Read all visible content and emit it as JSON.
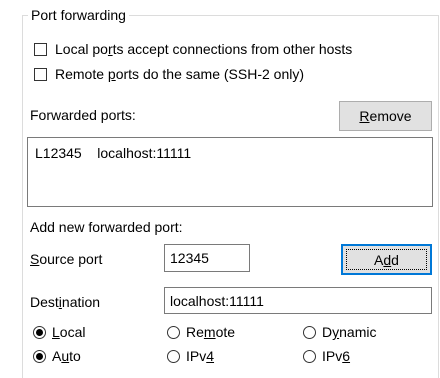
{
  "group": {
    "title": "Port forwarding"
  },
  "checkboxes": {
    "local": {
      "pre": "Local po",
      "key": "r",
      "post": "ts accept connections from other hosts",
      "checked": false
    },
    "remote": {
      "pre": "Remote ",
      "key": "p",
      "post": "orts do the same (SSH-2 only)",
      "checked": false
    }
  },
  "forwarded": {
    "label": "Forwarded ports:",
    "remove_button": {
      "pre": "",
      "key": "R",
      "post": "emove"
    },
    "items": [
      {
        "source": "L12345",
        "dest": "localhost:11111"
      }
    ]
  },
  "add_new": {
    "label": "Add new forwarded port:",
    "source_label": {
      "pre": "",
      "key": "S",
      "post": "ource port"
    },
    "source_value": "12345",
    "add_button": {
      "pre": "A",
      "key": "d",
      "post": "d"
    },
    "destination_label": {
      "pre": "Dest",
      "key": "i",
      "post": "nation"
    },
    "destination_value": "localhost:11111"
  },
  "direction": {
    "local": {
      "pre": "",
      "key": "L",
      "post": "ocal",
      "checked": true
    },
    "remote": {
      "pre": "Re",
      "key": "m",
      "post": "ote",
      "checked": false
    },
    "dynamic": {
      "pre": "D",
      "key": "y",
      "post": "namic",
      "checked": false
    }
  },
  "protocol": {
    "auto": {
      "pre": "A",
      "key": "u",
      "post": "to",
      "checked": true
    },
    "ipv4": {
      "pre": "IPv",
      "key": "4",
      "post": "",
      "checked": false
    },
    "ipv6": {
      "pre": "IPv",
      "key": "6",
      "post": "",
      "checked": false
    }
  }
}
